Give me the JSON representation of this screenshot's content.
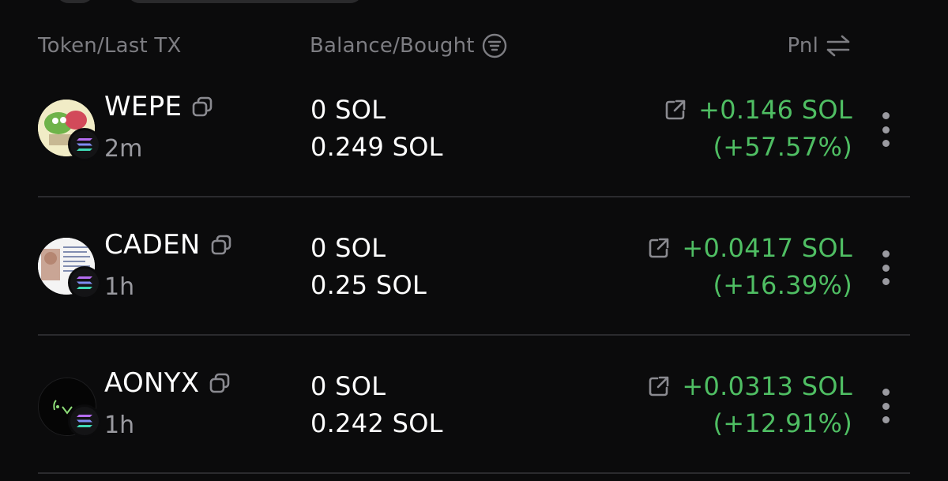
{
  "header": {
    "token_col": "Token/Last TX",
    "balance_col": "Balance/Bought",
    "pnl_col": "Pnl",
    "balance_icon": "list-sort-icon",
    "pnl_icon": "swap-arrows-icon"
  },
  "colors": {
    "background": "#0b0b0c",
    "positive": "#4fbe63",
    "muted": "#7d7d82",
    "divider": "#2b2b2e"
  },
  "rows": [
    {
      "token": "WEPE",
      "last_tx": "2m",
      "balance": "0 SOL",
      "bought": "0.249 SOL",
      "pnl_value": "+0.146 SOL",
      "pnl_percent": "(+57.57%)",
      "chain": "solana-icon"
    },
    {
      "token": "CADEN",
      "last_tx": "1h",
      "balance": "0 SOL",
      "bought": "0.25 SOL",
      "pnl_value": "+0.0417 SOL",
      "pnl_percent": "(+16.39%)",
      "chain": "solana-icon"
    },
    {
      "token": "AONYX",
      "last_tx": "1h",
      "balance": "0 SOL",
      "bought": "0.242 SOL",
      "pnl_value": "+0.0313 SOL",
      "pnl_percent": "(+12.91%)",
      "chain": "solana-icon"
    }
  ]
}
